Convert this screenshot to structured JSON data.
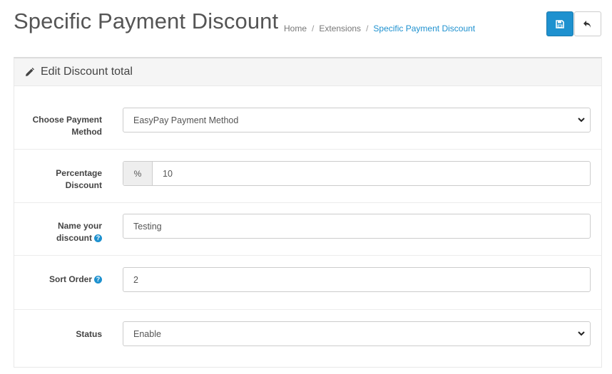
{
  "header": {
    "title": "Specific Payment Discount",
    "breadcrumb": [
      "Home",
      "Extensions",
      "Specific Payment Discount"
    ],
    "save_icon": "floppy-disk-icon",
    "back_icon": "reply-arrow-icon",
    "accent_color": "#1e91cf"
  },
  "panel": {
    "icon": "pencil-icon",
    "title": "Edit Discount total"
  },
  "form": {
    "payment_method": {
      "label_line1": "Choose Payment",
      "label_line2": "Method",
      "value": "EasyPay Payment Method"
    },
    "percentage": {
      "label_line1": "Percentage",
      "label_line2": "Discount",
      "addon": "%",
      "value": "10"
    },
    "name": {
      "label_line1": "Name your",
      "label_line2": "discount",
      "help": "?",
      "value": "Testing"
    },
    "sort_order": {
      "label": "Sort Order",
      "help": "?",
      "value": "2"
    },
    "status": {
      "label": "Status",
      "value": "Enable"
    }
  }
}
